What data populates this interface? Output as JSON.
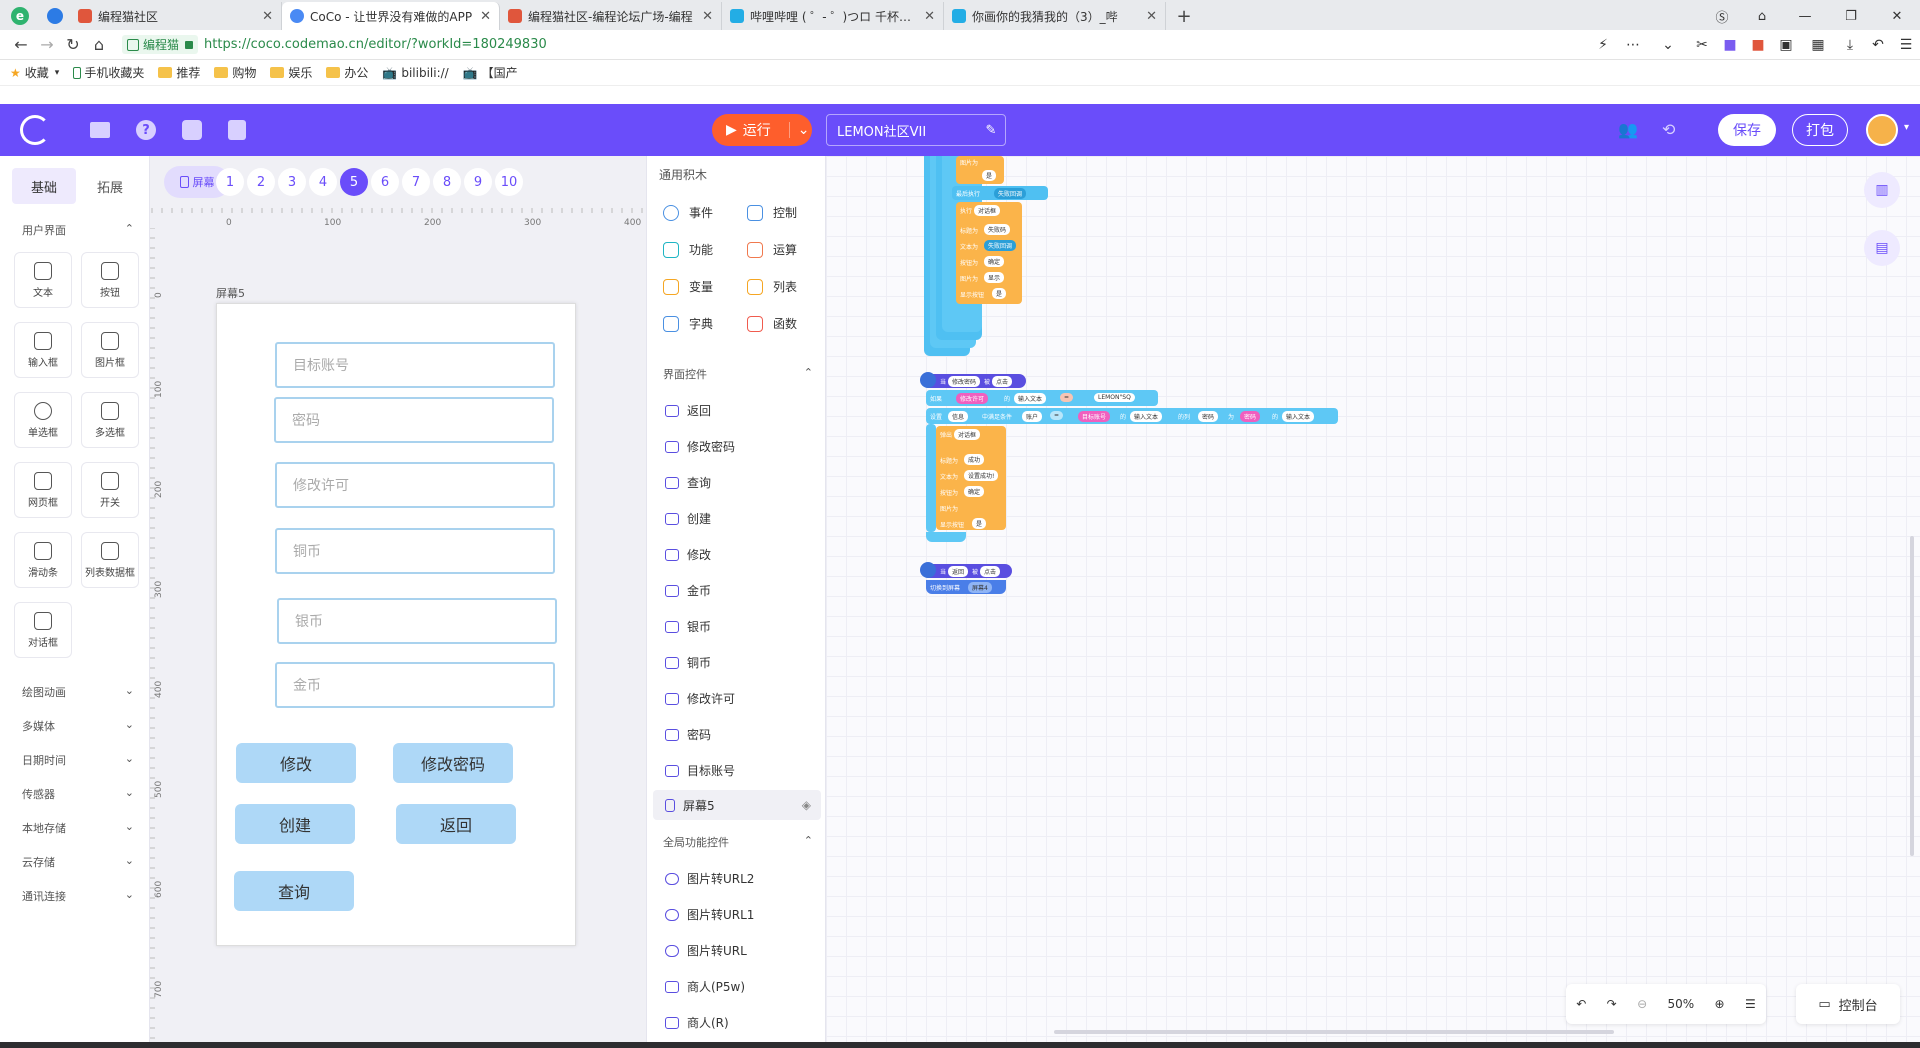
{
  "browser": {
    "tabs": [
      {
        "title": "编程猫社区",
        "color": "#e0563c"
      },
      {
        "title": "CoCo - 让世界没有难做的APP",
        "color": "#4a8af4"
      },
      {
        "title": "编程猫社区-编程论坛广场-编程",
        "color": "#e0563c"
      },
      {
        "title": "哔哩哔哩 ( ゜- ゜)つロ 千杯~-bi",
        "color": "#23ade5"
      },
      {
        "title": "你画你的我猜我的（3）_哔",
        "color": "#23ade5"
      }
    ],
    "site_badge": "编程猫",
    "url": "https://coco.codemao.cn/editor/?workId=180249830",
    "bookmarks": [
      "收藏",
      "手机收藏夹",
      "推荐",
      "购物",
      "娱乐",
      "办公",
      "bilibili://",
      "【国产"
    ]
  },
  "app": {
    "run_label": "运行",
    "project_name": "LEMON社区VII",
    "save_label": "保存",
    "package_label": "打包",
    "accent": "#6a4dfa",
    "run_color": "#fe5e2c"
  },
  "left_panel": {
    "tabs": [
      "基础",
      "拓展"
    ],
    "section_title": "用户界面",
    "widgets": [
      "文本",
      "按钮",
      "输入框",
      "图片框",
      "单选框",
      "多选框",
      "网页框",
      "开关",
      "滑动条",
      "列表数据框",
      "对话框"
    ],
    "categories": [
      "绘图动画",
      "多媒体",
      "日期时间",
      "传感器",
      "本地存储",
      "云存储",
      "通讯连接"
    ]
  },
  "screens": {
    "screen_button": "屏幕",
    "numbers": [
      "1",
      "2",
      "3",
      "4",
      "5",
      "6",
      "7",
      "8",
      "9",
      "10"
    ],
    "active": "5",
    "ruler_top": [
      "0",
      "100",
      "200",
      "300",
      "400"
    ],
    "ruler_left": [
      "0",
      "100",
      "200",
      "300",
      "400",
      "500",
      "600",
      "700"
    ],
    "screen_label": "屏幕5"
  },
  "phone": {
    "fields": [
      "目标账号",
      "密码",
      "修改许可",
      "铜币",
      "银币",
      "金币"
    ],
    "buttons": [
      "修改",
      "修改密码",
      "创建",
      "返回",
      "查询"
    ],
    "button_color": "#aed8f7",
    "field_border": "#a9d2ee"
  },
  "block_palette": {
    "general_title": "通用积木",
    "categories": [
      {
        "label": "事件",
        "color": "#4a90e2"
      },
      {
        "label": "控制",
        "color": "#4a90e2"
      },
      {
        "label": "功能",
        "color": "#1fb5c4"
      },
      {
        "label": "运算",
        "color": "#f0794e"
      },
      {
        "label": "变量",
        "color": "#f5a623"
      },
      {
        "label": "列表",
        "color": "#f5a623"
      },
      {
        "label": "字典",
        "color": "#4a90e2"
      },
      {
        "label": "函数",
        "color": "#f05b4e"
      }
    ],
    "ui_title": "界面控件",
    "ui_widgets": [
      "返回",
      "修改密码",
      "查询",
      "创建",
      "修改",
      "金币",
      "银币",
      "铜币",
      "修改许可",
      "密码",
      "目标账号",
      "屏幕5"
    ],
    "global_title": "全局功能控件",
    "global_widgets": [
      "图片转URL2",
      "图片转URL1",
      "图片转URL",
      "商人(P5w)",
      "商人(R)"
    ]
  },
  "workspace": {
    "zoom": "50%",
    "console_label": "控制台",
    "blocks": {
      "top_frag": [
        "图片为",
        "是",
        "最后执行",
        "失败回调",
        "执行",
        "对话框",
        "标题为",
        "失败码",
        "文本为",
        "失败回调",
        "按钮为",
        "确定",
        "图片为",
        "显示",
        "显示按钮",
        "是"
      ],
      "mid_event": [
        "当",
        "修改密码",
        "被",
        "点击"
      ],
      "mid_if": [
        "如果",
        "修改许可",
        "的",
        "输入文本",
        "=",
        "LEMON\"SQ"
      ],
      "mid_set": [
        "设置",
        "信息",
        "中满足条件",
        "账户",
        "=",
        "目标账号",
        "的",
        "输入文本",
        "的列",
        "密码",
        "为",
        "密码",
        "的",
        "输入文本"
      ],
      "mid_dialog": [
        "弹出",
        "对话框",
        "标题为",
        "成功",
        "文本为",
        "设置成功!",
        "按钮为",
        "确定",
        "图片为",
        "显示按钮",
        "是"
      ],
      "bottom_event": [
        "当",
        "返回",
        "被",
        "点击"
      ],
      "bottom_switch": [
        "切换到屏幕",
        "屏幕4"
      ]
    }
  }
}
